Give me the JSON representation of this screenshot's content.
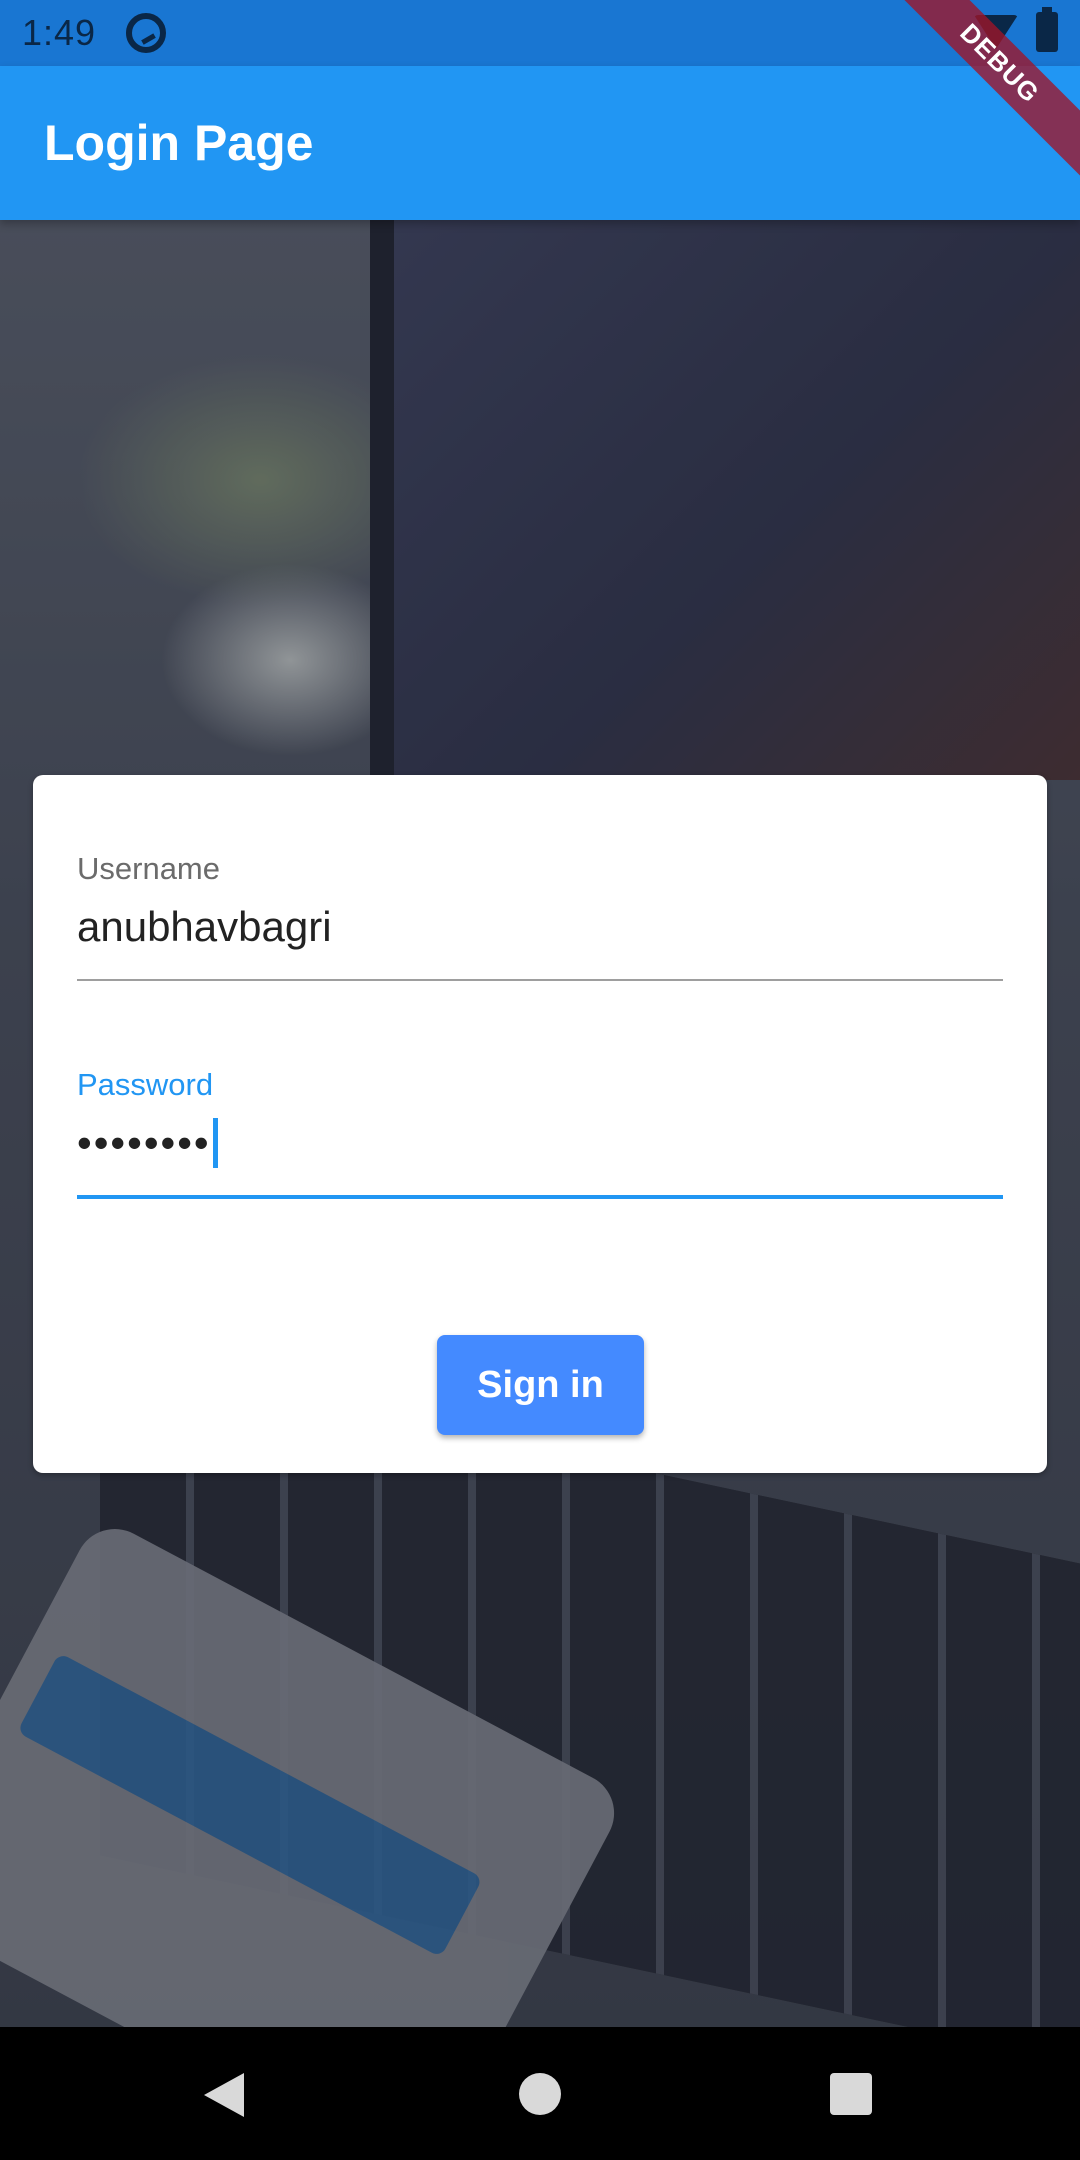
{
  "status_bar": {
    "time": "1:49",
    "icons": [
      "app-notification-icon",
      "wifi-icon",
      "battery-icon"
    ]
  },
  "debug_banner": "DEBUG",
  "app_bar": {
    "title": "Login Page",
    "color": "#2196F3"
  },
  "login_form": {
    "username": {
      "label": "Username",
      "value": "anubhavbagri"
    },
    "password": {
      "label": "Password",
      "value": "••••••••",
      "focused": true
    },
    "submit_label": "Sign in",
    "accent_color": "#448AFF"
  },
  "nav_bar": {
    "icons": [
      "back-icon",
      "home-icon",
      "recents-icon"
    ]
  }
}
